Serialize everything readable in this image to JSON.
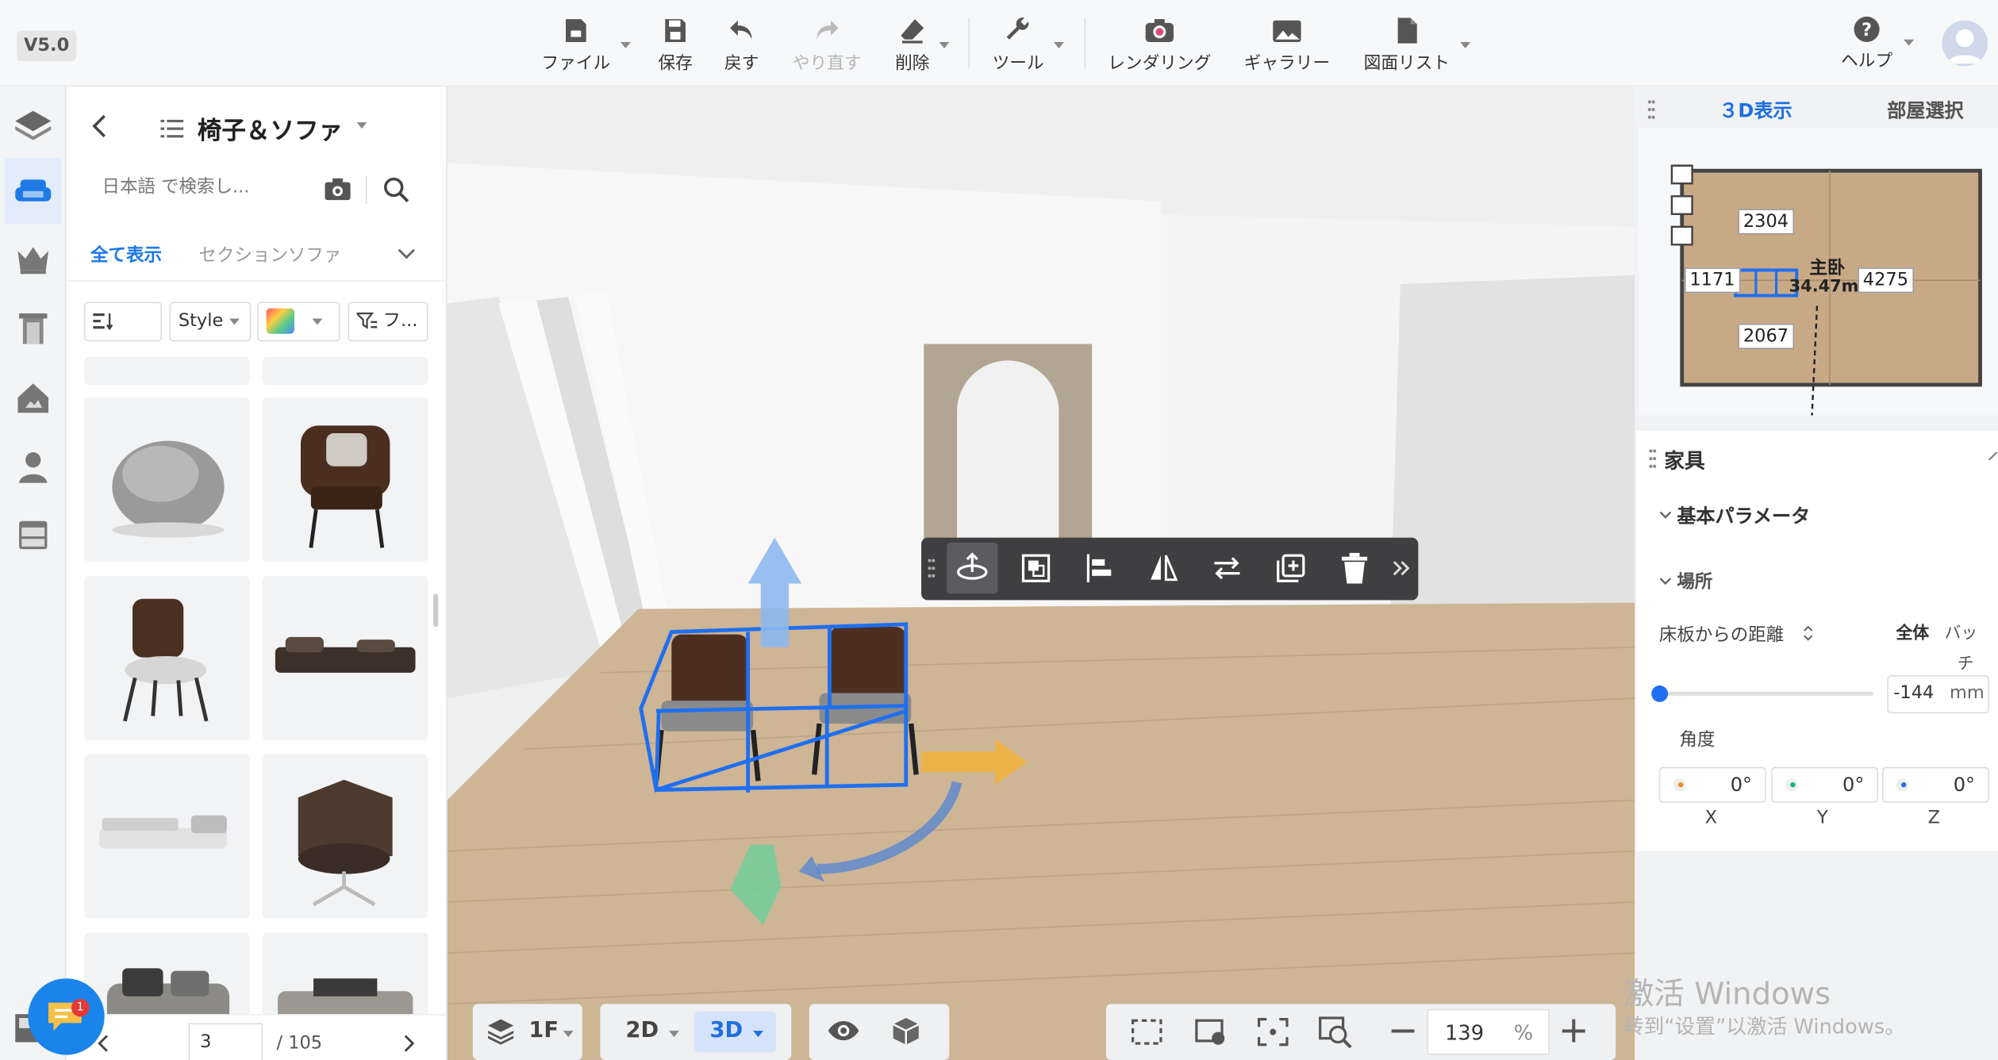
{
  "app": {
    "version": "V5.0"
  },
  "toolbar": {
    "file": "ファイル",
    "save": "保存",
    "undo": "戻す",
    "redo": "やり直す",
    "delete": "削除",
    "tools": "ツール",
    "rendering": "レンダリング",
    "gallery": "ギャラリー",
    "drawing_list": "図面リスト",
    "help": "ヘルプ"
  },
  "sidebar": {
    "items": [
      "floor-plan-icon",
      "furniture-icon",
      "decor-icon",
      "door-icon",
      "scene-icon",
      "person-icon",
      "cabinet-icon"
    ],
    "active": 1
  },
  "catalog": {
    "title": "椅子＆ソファ",
    "search_placeholder": "日本語 で検索し...",
    "tabs": [
      "全て表示",
      "セクションソファ"
    ],
    "filter_style": "Style",
    "filter_more": "フ...",
    "filter_sort_icon": "sort-icon",
    "items": [
      "bean-bag-chair",
      "leather-armchair",
      "dining-chair",
      "low-sofa",
      "sectional-sofa",
      "swivel-lounge-chair",
      "cushion-sofa",
      "modular-sofa"
    ],
    "page": "3",
    "total_pages": "/ 105"
  },
  "view_controls": {
    "floor": "1F",
    "mode_2d": "2D",
    "mode_3d": "3D",
    "zoom": "139",
    "zoom_unit": "%"
  },
  "right_panel": {
    "tab_3d": "３D表示",
    "tab_room": "部屋選択",
    "plan": {
      "dims": [
        "2304",
        "1171",
        "4275",
        "2067"
      ],
      "room_name": "主卧",
      "room_area": "34.47m"
    },
    "card": {
      "title": "家具",
      "basic_params": "基本パラメータ",
      "location": "場所",
      "floor_distance": "床板からの距離",
      "all": "全体",
      "batch_1": "バッ",
      "batch_2": "チ",
      "distance_value": "-144",
      "distance_unit": "mm",
      "angle": "角度",
      "angles": [
        {
          "axis": "X",
          "value": "0°",
          "color": "#f08a24"
        },
        {
          "axis": "Y",
          "value": "0°",
          "color": "#19b38b"
        },
        {
          "axis": "Z",
          "value": "0°",
          "color": "#2a6ee0"
        }
      ]
    }
  },
  "watermark": {
    "line1": "激活 Windows",
    "line2": "转到“设置”以激活 Windows。"
  },
  "chat": {
    "badge": "1"
  }
}
